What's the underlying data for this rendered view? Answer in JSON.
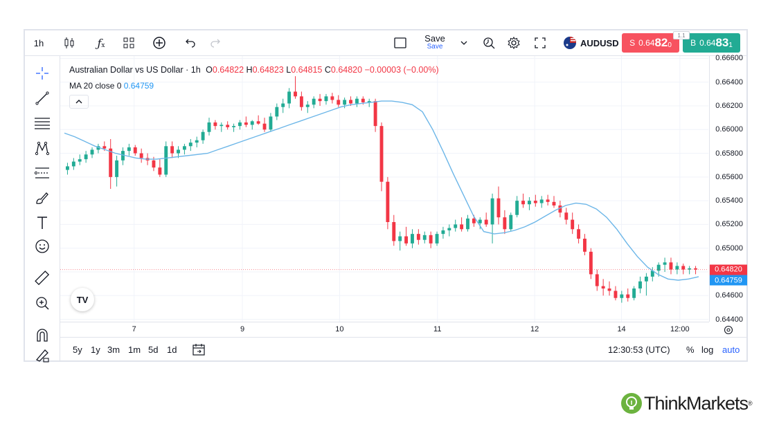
{
  "toolbar": {
    "interval": "1h",
    "save_label": "Save",
    "save_sub": "Save",
    "symbol": "AUDUSD",
    "sell_prefix": "S",
    "sell_small": "0.64",
    "sell_big": "82",
    "sell_tail": "0",
    "buy_prefix": "B",
    "buy_small": "0.64",
    "buy_big": "83",
    "buy_tail": "1",
    "spread": "1.1",
    "icons": [
      "candles-icon",
      "function-icon",
      "templates-icon",
      "add-indicator-icon",
      "undo-icon",
      "redo-icon",
      "layout-icon",
      "chevron-down-icon",
      "replay-icon",
      "gear-icon",
      "fullscreen-icon",
      "flag-icon"
    ]
  },
  "left_tools": [
    "crosshair-icon",
    "trend-line-icon",
    "horizontal-lines-icon",
    "pattern-icon",
    "fib-icon",
    "brush-icon",
    "text-icon",
    "emoji-icon",
    "ruler-icon",
    "zoom-icon",
    "magnet-icon",
    "lock-pencil-icon"
  ],
  "legend": {
    "title": "Australian Dollar vs US Dollar · 1h",
    "o_label": "O",
    "o_val": "0.64822",
    "h_label": "H",
    "h_val": "0.64823",
    "l_label": "L",
    "l_val": "0.64815",
    "c_label": "C",
    "c_val": "0.64820",
    "change": "−0.00003 (−0.00%)",
    "ma_label": "MA 20 close 0",
    "ma_val": "0.64759"
  },
  "logo_text": "TV",
  "yaxis": {
    "ticks": [
      "0.66600",
      "0.66400",
      "0.66200",
      "0.66000",
      "0.65800",
      "0.65600",
      "0.65400",
      "0.65200",
      "0.65000",
      "0.64800",
      "0.64600",
      "0.64400"
    ],
    "price_tag": "0.64820",
    "ma_tag": "0.64759"
  },
  "xaxis": {
    "ticks": [
      "7",
      "9",
      "10",
      "11",
      "12",
      "14",
      "12:00"
    ]
  },
  "bottom": {
    "ranges": [
      "5y",
      "1y",
      "3m",
      "1m",
      "5d",
      "1d"
    ],
    "clock": "12:30:53 (UTC)",
    "pct": "%",
    "log": "log",
    "auto": "auto"
  },
  "brand": {
    "name": "ThinkMarkets",
    "reg": "®"
  },
  "colors": {
    "up": "#22ab94",
    "down": "#f23645",
    "ma": "#6cb6e8",
    "accent": "#2962ff",
    "brand_green": "#6cb33f"
  },
  "chart_data": {
    "type": "candlestick",
    "ylim": [
      0.6438,
      0.6662
    ],
    "x_ticks": [
      "7",
      "9",
      "10",
      "11",
      "12",
      "14",
      "12:00"
    ],
    "series": [
      {
        "name": "Australian Dollar vs US Dollar · 1h",
        "values": [
          [
            0.6566,
            0.6572,
            0.6562,
            0.6569
          ],
          [
            0.6569,
            0.6576,
            0.6566,
            0.6573
          ],
          [
            0.6573,
            0.6579,
            0.657,
            0.6575
          ],
          [
            0.6575,
            0.6582,
            0.6572,
            0.6579
          ],
          [
            0.6579,
            0.6585,
            0.6576,
            0.6583
          ],
          [
            0.6583,
            0.6588,
            0.658,
            0.6586
          ],
          [
            0.6586,
            0.659,
            0.6582,
            0.6584
          ],
          [
            0.6584,
            0.6592,
            0.655,
            0.656
          ],
          [
            0.656,
            0.6578,
            0.6552,
            0.6574
          ],
          [
            0.6574,
            0.6585,
            0.657,
            0.6582
          ],
          [
            0.6582,
            0.6588,
            0.6578,
            0.6585
          ],
          [
            0.6585,
            0.6587,
            0.6578,
            0.658
          ],
          [
            0.658,
            0.6584,
            0.6572,
            0.6576
          ],
          [
            0.6576,
            0.658,
            0.657,
            0.6574
          ],
          [
            0.6574,
            0.6577,
            0.6565,
            0.6568
          ],
          [
            0.6568,
            0.6575,
            0.656,
            0.6562
          ],
          [
            0.6562,
            0.659,
            0.656,
            0.6586
          ],
          [
            0.6586,
            0.659,
            0.6576,
            0.658
          ],
          [
            0.658,
            0.6586,
            0.6576,
            0.6583
          ],
          [
            0.6583,
            0.6588,
            0.6579,
            0.6586
          ],
          [
            0.6586,
            0.6592,
            0.6582,
            0.6589
          ],
          [
            0.6589,
            0.6594,
            0.6585,
            0.6591
          ],
          [
            0.6591,
            0.66,
            0.6588,
            0.6598
          ],
          [
            0.6598,
            0.661,
            0.6595,
            0.6606
          ],
          [
            0.6606,
            0.6608,
            0.66,
            0.6603
          ],
          [
            0.6603,
            0.6606,
            0.6598,
            0.6604
          ],
          [
            0.6604,
            0.6607,
            0.66,
            0.6602
          ],
          [
            0.6602,
            0.6605,
            0.6598,
            0.6603
          ],
          [
            0.6603,
            0.6608,
            0.66,
            0.6606
          ],
          [
            0.6606,
            0.6611,
            0.6602,
            0.6604
          ],
          [
            0.6604,
            0.6608,
            0.66,
            0.6607
          ],
          [
            0.6607,
            0.6612,
            0.6604,
            0.6605
          ],
          [
            0.6605,
            0.661,
            0.6598,
            0.66
          ],
          [
            0.66,
            0.6614,
            0.6598,
            0.6611
          ],
          [
            0.6611,
            0.6622,
            0.6608,
            0.6619
          ],
          [
            0.6619,
            0.6626,
            0.6614,
            0.6622
          ],
          [
            0.6622,
            0.6635,
            0.6618,
            0.6632
          ],
          [
            0.6632,
            0.6645,
            0.6626,
            0.6628
          ],
          [
            0.6628,
            0.6632,
            0.6616,
            0.6619
          ],
          [
            0.6619,
            0.6624,
            0.6614,
            0.6621
          ],
          [
            0.6621,
            0.6628,
            0.6618,
            0.6626
          ],
          [
            0.6626,
            0.663,
            0.662,
            0.6624
          ],
          [
            0.6624,
            0.663,
            0.6621,
            0.6628
          ],
          [
            0.6628,
            0.6631,
            0.6622,
            0.6625
          ],
          [
            0.6625,
            0.6629,
            0.6619,
            0.6621
          ],
          [
            0.6621,
            0.6627,
            0.6618,
            0.6625
          ],
          [
            0.6625,
            0.6628,
            0.662,
            0.6622
          ],
          [
            0.6622,
            0.6628,
            0.6619,
            0.6626
          ],
          [
            0.6626,
            0.6628,
            0.6621,
            0.6623
          ],
          [
            0.6623,
            0.6626,
            0.6619,
            0.6624
          ],
          [
            0.6624,
            0.6626,
            0.6598,
            0.6603
          ],
          [
            0.6603,
            0.6606,
            0.6548,
            0.6556
          ],
          [
            0.6556,
            0.656,
            0.6516,
            0.6522
          ],
          [
            0.6522,
            0.6528,
            0.6502,
            0.6506
          ],
          [
            0.6506,
            0.6514,
            0.6498,
            0.651
          ],
          [
            0.651,
            0.6518,
            0.6502,
            0.6504
          ],
          [
            0.6504,
            0.6516,
            0.65,
            0.6512
          ],
          [
            0.6512,
            0.6516,
            0.6503,
            0.6507
          ],
          [
            0.6507,
            0.6514,
            0.6504,
            0.6511
          ],
          [
            0.6511,
            0.6514,
            0.65,
            0.6504
          ],
          [
            0.6504,
            0.6514,
            0.6502,
            0.6512
          ],
          [
            0.6512,
            0.6518,
            0.6508,
            0.6515
          ],
          [
            0.6515,
            0.652,
            0.651,
            0.6517
          ],
          [
            0.6517,
            0.6524,
            0.6514,
            0.652
          ],
          [
            0.652,
            0.6526,
            0.6514,
            0.6516
          ],
          [
            0.6516,
            0.6528,
            0.6514,
            0.6525
          ],
          [
            0.6525,
            0.6528,
            0.6518,
            0.6521
          ],
          [
            0.6521,
            0.6526,
            0.6516,
            0.6524
          ],
          [
            0.6524,
            0.653,
            0.6518,
            0.652
          ],
          [
            0.652,
            0.6546,
            0.6504,
            0.6542
          ],
          [
            0.6542,
            0.6552,
            0.652,
            0.6526
          ],
          [
            0.6526,
            0.6532,
            0.6512,
            0.6516
          ],
          [
            0.6516,
            0.653,
            0.6514,
            0.6528
          ],
          [
            0.6528,
            0.6544,
            0.6526,
            0.654
          ],
          [
            0.654,
            0.6546,
            0.6534,
            0.6537
          ],
          [
            0.6537,
            0.6543,
            0.6532,
            0.654
          ],
          [
            0.654,
            0.6545,
            0.6535,
            0.6538
          ],
          [
            0.6538,
            0.6544,
            0.6534,
            0.6541
          ],
          [
            0.6541,
            0.6545,
            0.6536,
            0.6539
          ],
          [
            0.6539,
            0.6544,
            0.6534,
            0.6536
          ],
          [
            0.6536,
            0.654,
            0.6526,
            0.653
          ],
          [
            0.653,
            0.6534,
            0.652,
            0.6524
          ],
          [
            0.6524,
            0.653,
            0.6512,
            0.6516
          ],
          [
            0.6516,
            0.652,
            0.6504,
            0.6508
          ],
          [
            0.6508,
            0.6512,
            0.6494,
            0.6497
          ],
          [
            0.6497,
            0.65,
            0.6474,
            0.6478
          ],
          [
            0.6478,
            0.6482,
            0.6464,
            0.6468
          ],
          [
            0.6468,
            0.6474,
            0.646,
            0.6466
          ],
          [
            0.6466,
            0.6472,
            0.646,
            0.6464
          ],
          [
            0.6464,
            0.6468,
            0.6456,
            0.6458
          ],
          [
            0.6458,
            0.6464,
            0.6454,
            0.6461
          ],
          [
            0.6461,
            0.6466,
            0.6455,
            0.6458
          ],
          [
            0.6458,
            0.6468,
            0.6456,
            0.6466
          ],
          [
            0.6466,
            0.6476,
            0.6462,
            0.6472
          ],
          [
            0.6472,
            0.6479,
            0.646,
            0.6476
          ],
          [
            0.6476,
            0.6484,
            0.6472,
            0.6481
          ],
          [
            0.6481,
            0.6488,
            0.6476,
            0.6486
          ],
          [
            0.6486,
            0.6492,
            0.648,
            0.6488
          ],
          [
            0.6488,
            0.6492,
            0.6478,
            0.6482
          ],
          [
            0.6482,
            0.6488,
            0.6478,
            0.6485
          ],
          [
            0.6485,
            0.6487,
            0.6478,
            0.6482
          ],
          [
            0.6482,
            0.6485,
            0.6478,
            0.6483
          ],
          [
            0.6483,
            0.6485,
            0.6478,
            0.6482
          ]
        ]
      },
      {
        "name": "MA 20 close 0",
        "values": [
          0.6597,
          0.6594,
          0.659,
          0.6586,
          0.6583,
          0.658,
          0.6578,
          0.6576,
          0.6575,
          0.6575,
          0.6576,
          0.6577,
          0.6578,
          0.6579,
          0.658,
          0.6583,
          0.6586,
          0.6589,
          0.6592,
          0.6595,
          0.6598,
          0.6601,
          0.6604,
          0.6607,
          0.661,
          0.6613,
          0.6616,
          0.6619,
          0.6621,
          0.6622,
          0.6623,
          0.6624,
          0.6624,
          0.6623,
          0.6621,
          0.6615,
          0.66,
          0.6582,
          0.6563,
          0.6545,
          0.6527,
          0.6514,
          0.6512,
          0.6513,
          0.6515,
          0.6518,
          0.6522,
          0.6527,
          0.6532,
          0.6536,
          0.6538,
          0.6537,
          0.6533,
          0.6526,
          0.6516,
          0.6504,
          0.6493,
          0.6484,
          0.6478,
          0.6474,
          0.6473,
          0.6474,
          0.6476
        ]
      }
    ]
  }
}
